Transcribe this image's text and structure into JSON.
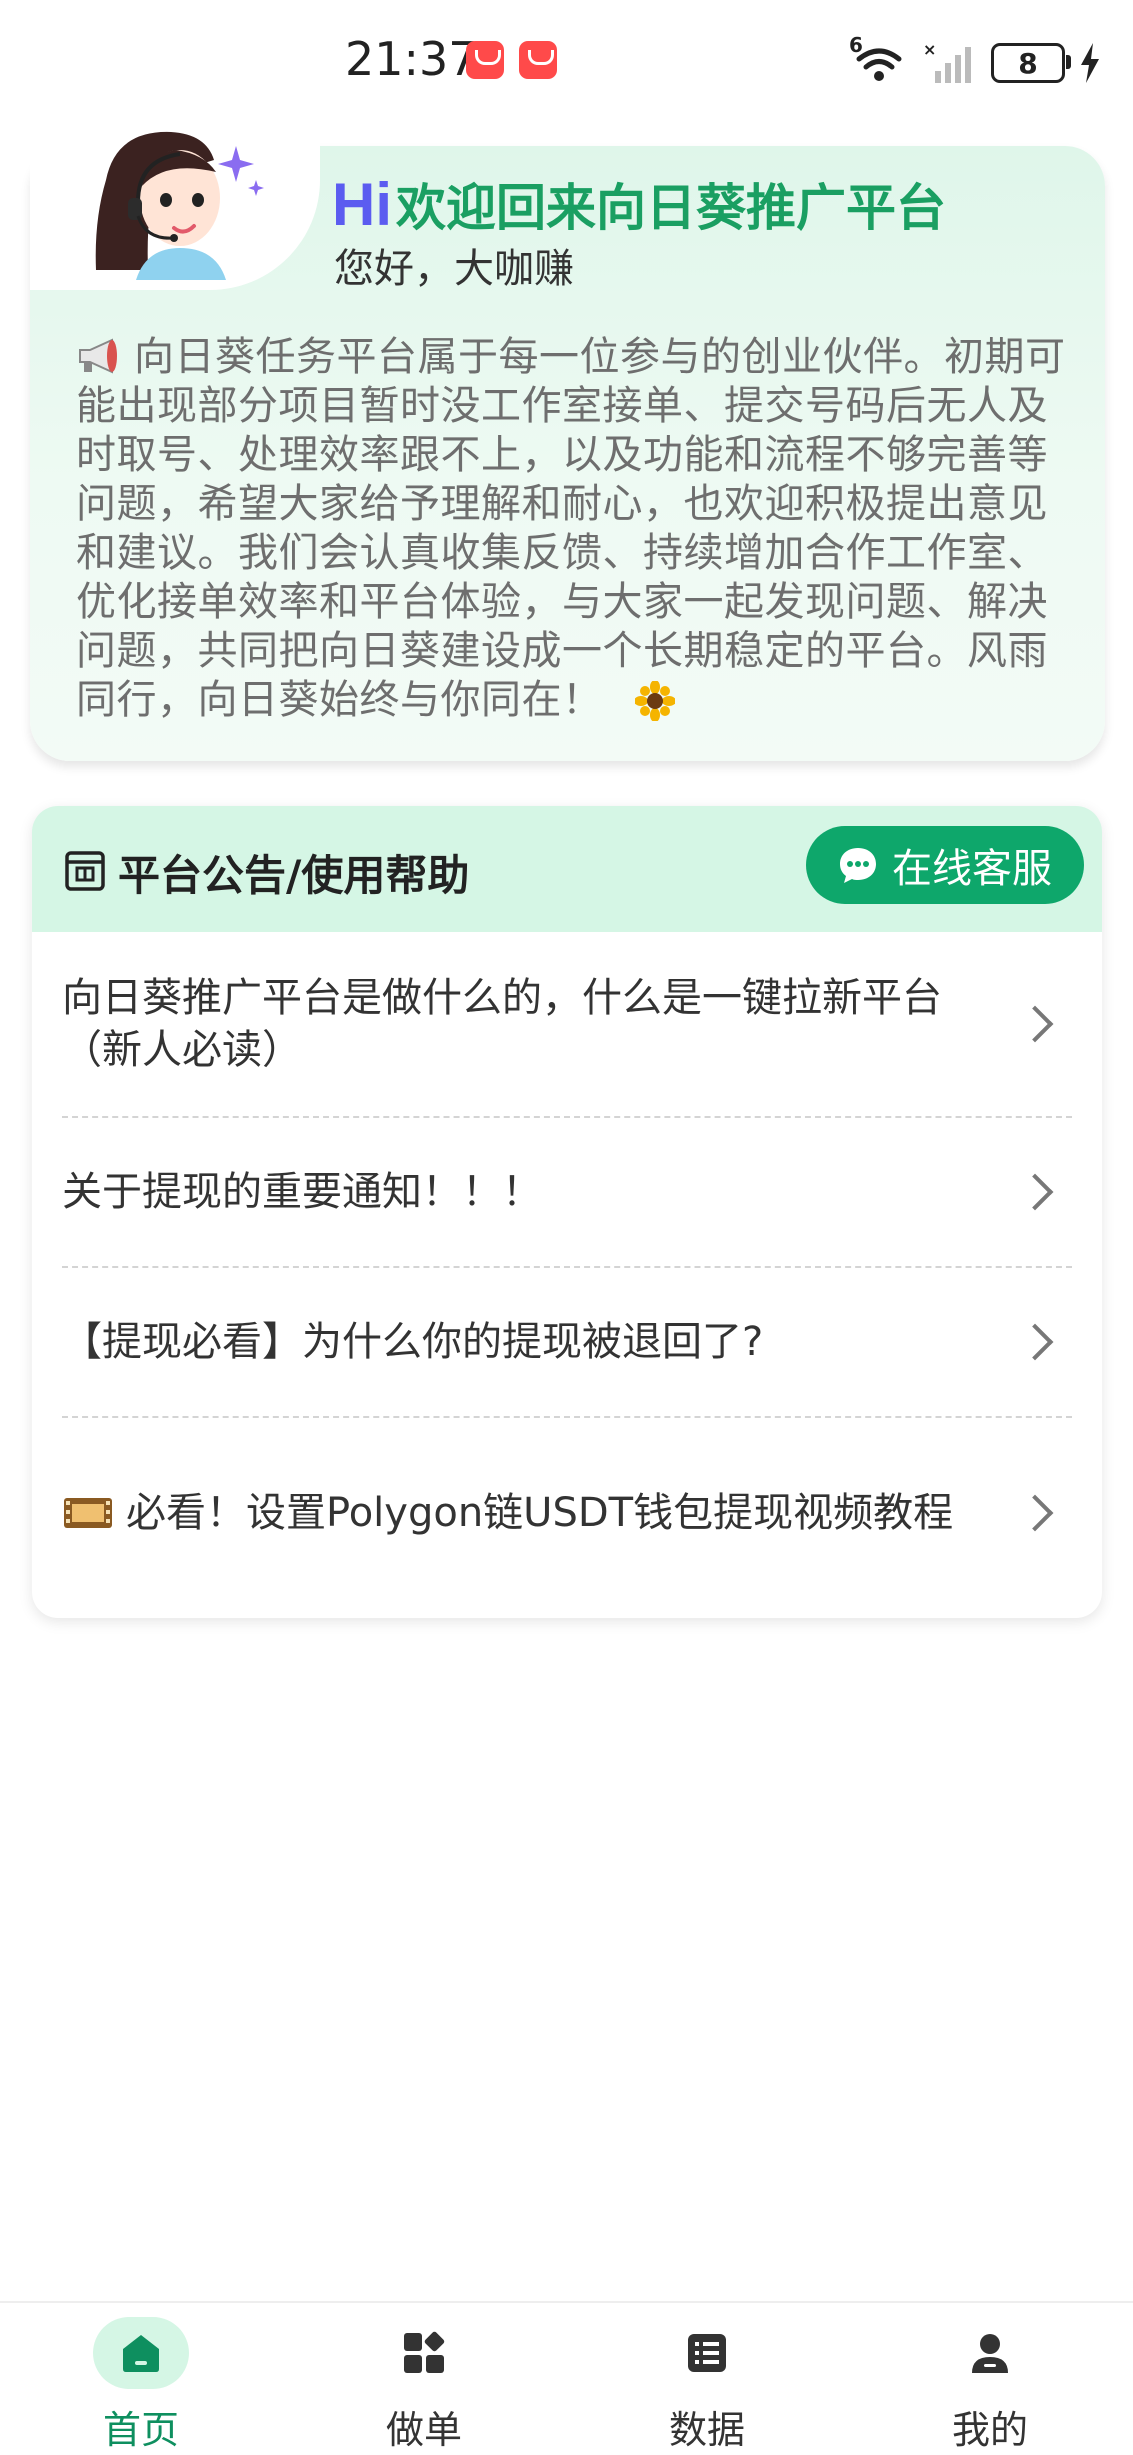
{
  "status_bar": {
    "time": "21:37",
    "network": "6",
    "battery": "8"
  },
  "welcome": {
    "hi": "Hi",
    "title": "欢迎回来向日葵推广平台",
    "greeting": "您好，大咖赚",
    "message": "向日葵任务平台属于每一位参与的创业伙伴。初期可能出现部分项目暂时没工作室接单、提交号码后无人及时取号、处理效率跟不上，以及功能和流程不够完善等问题，希望大家给予理解和耐心，也欢迎积极提出意见和建议。我们会认真收集反馈、持续增加合作工作室、优化接单效率和平台体验，与大家一起发现问题、解决问题，共同把向日葵建设成一个长期稳定的平台。风雨同行，向日葵始终与你同在！"
  },
  "notices": {
    "title": "平台公告/使用帮助",
    "service_button": "在线客服",
    "items": [
      {
        "text": "向日葵推广平台是做什么的，什么是一键拉新平台（新人必读）"
      },
      {
        "text": "关于提现的重要通知！！！"
      },
      {
        "text": "【提现必看】为什么你的提现被退回了?"
      },
      {
        "text": "必看！设置Polygon链USDT钱包提现视频教程"
      }
    ]
  },
  "bottom_nav": {
    "items": [
      {
        "label": "首页",
        "icon": "home-icon",
        "active": true
      },
      {
        "label": "做单",
        "icon": "grid-icon",
        "active": false
      },
      {
        "label": "数据",
        "icon": "list-icon",
        "active": false
      },
      {
        "label": "我的",
        "icon": "user-icon",
        "active": false
      }
    ]
  },
  "colors": {
    "accent": "#0ea76b",
    "title_green": "#1a9f62",
    "hi_purple": "#5b5cf0",
    "header_bg": "#d5f6e5"
  }
}
